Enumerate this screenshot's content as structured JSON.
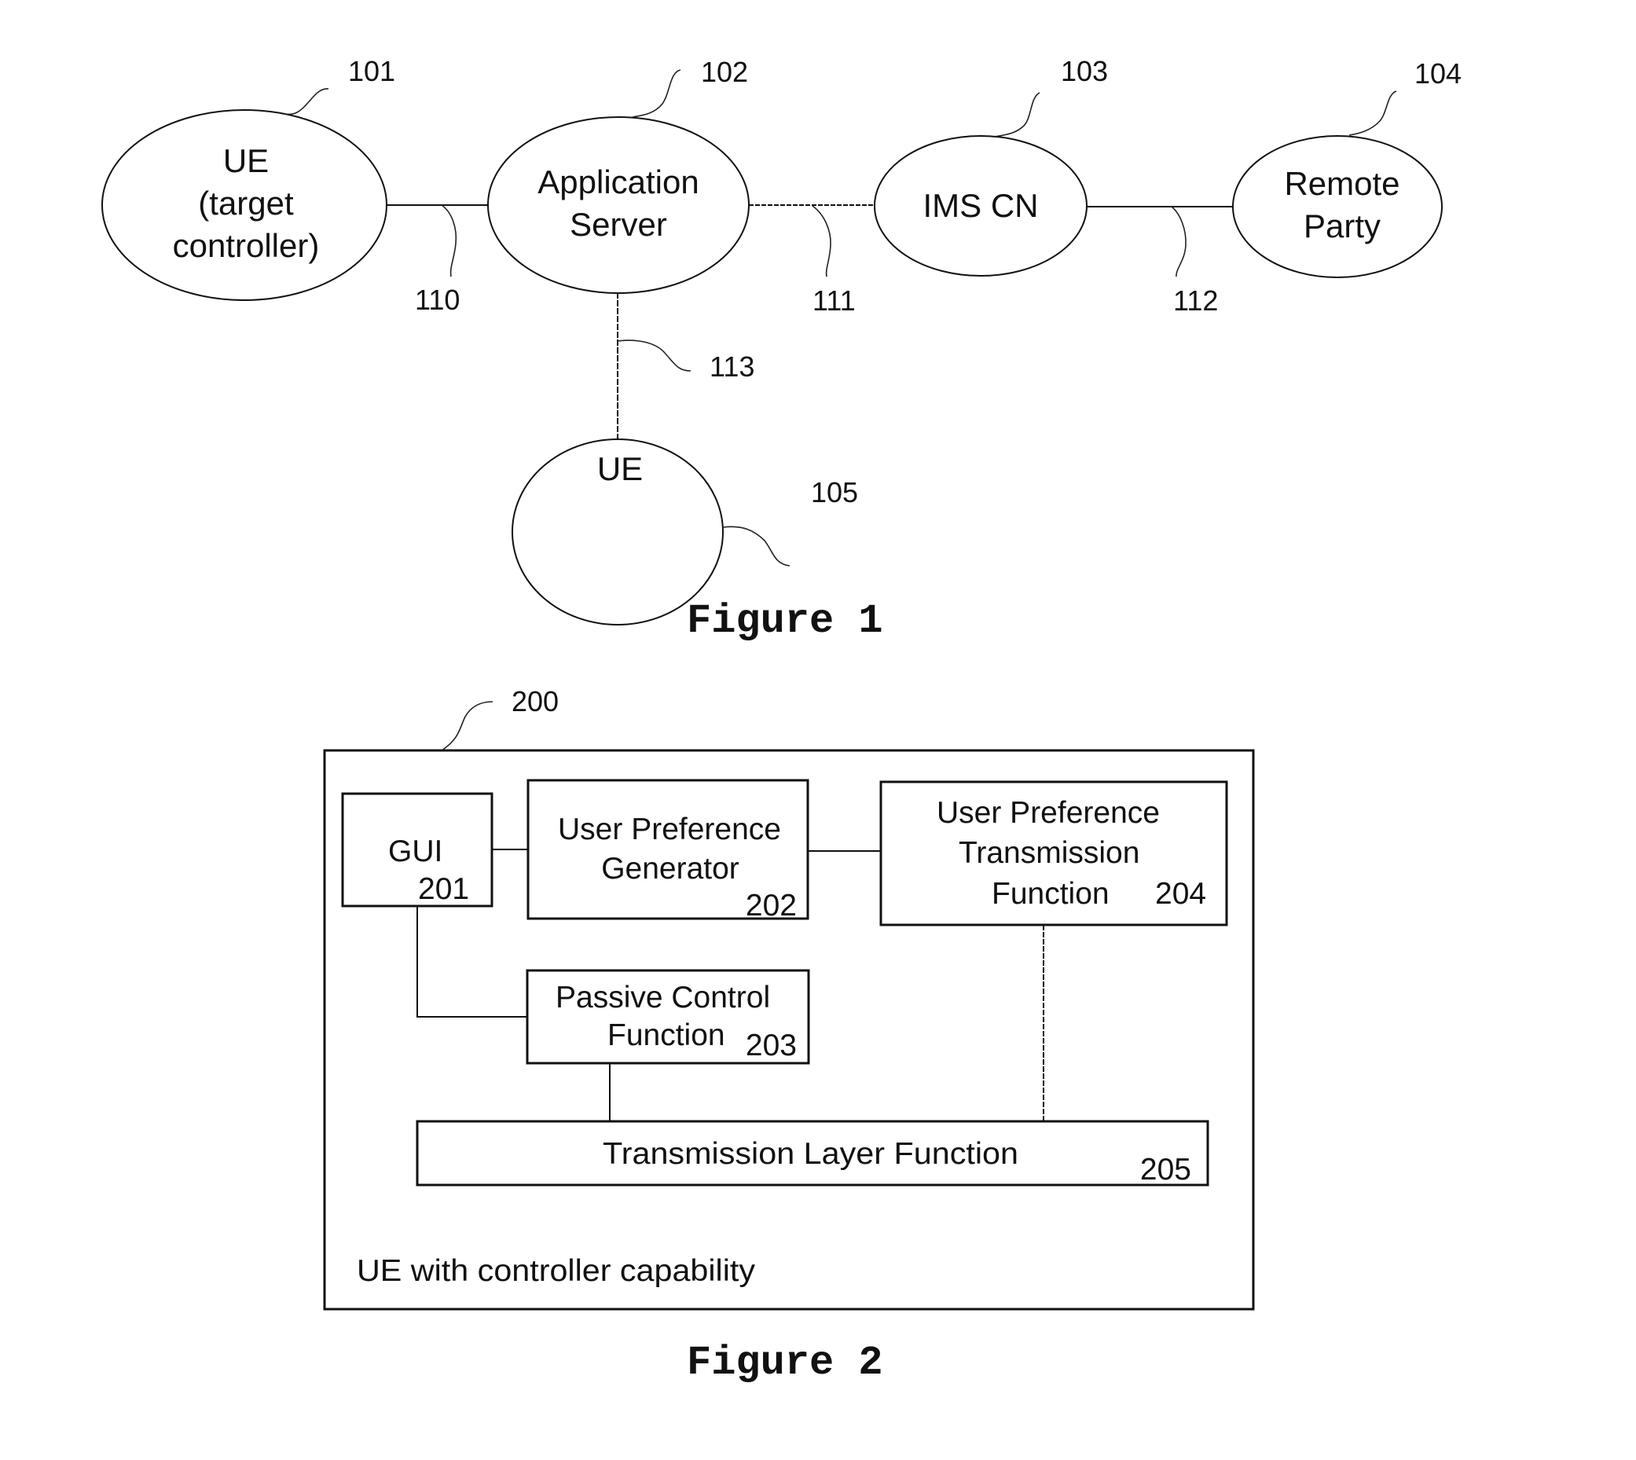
{
  "figure1": {
    "caption": "Figure 1",
    "nodes": [
      {
        "id": "101",
        "lines": [
          "UE",
          "(target",
          "controller)"
        ]
      },
      {
        "id": "102",
        "lines": [
          "Application",
          "Server"
        ]
      },
      {
        "id": "103",
        "lines": [
          "IMS CN"
        ]
      },
      {
        "id": "104",
        "lines": [
          "Remote",
          "Party"
        ]
      },
      {
        "id": "105",
        "lines": [
          "UE"
        ]
      }
    ],
    "links": [
      {
        "id": "110",
        "from": "101",
        "to": "102"
      },
      {
        "id": "111",
        "from": "102",
        "to": "103"
      },
      {
        "id": "112",
        "from": "103",
        "to": "104"
      },
      {
        "id": "113",
        "from": "102",
        "to": "105"
      }
    ]
  },
  "figure2": {
    "caption": "Figure 2",
    "container": {
      "id": "200",
      "label": "UE with controller capability"
    },
    "blocks": [
      {
        "id": "201",
        "lines": [
          "GUI"
        ]
      },
      {
        "id": "202",
        "lines": [
          "User Preference",
          "Generator"
        ]
      },
      {
        "id": "203",
        "lines": [
          "Passive Control",
          "Function"
        ]
      },
      {
        "id": "204",
        "lines": [
          "User Preference",
          "Transmission",
          "Function"
        ]
      },
      {
        "id": "205",
        "lines": [
          "Transmission Layer Function"
        ]
      }
    ],
    "connections": [
      {
        "from": "201",
        "to": "202"
      },
      {
        "from": "202",
        "to": "204"
      },
      {
        "from": "201",
        "to": "203"
      },
      {
        "from": "203",
        "to": "205"
      },
      {
        "from": "204",
        "to": "205"
      }
    ]
  }
}
